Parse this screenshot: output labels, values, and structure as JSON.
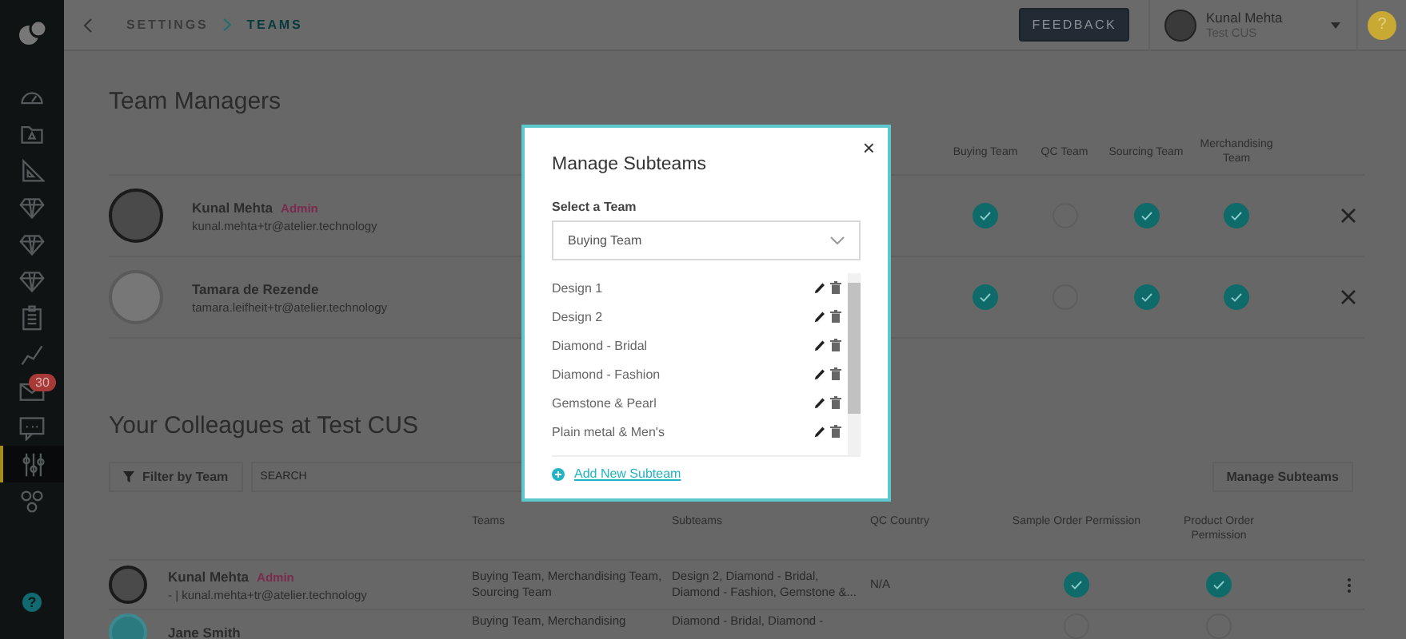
{
  "sidebar": {
    "items": [
      {
        "kind": "dashboard",
        "selected": false
      },
      {
        "kind": "folder",
        "selected": false
      },
      {
        "kind": "ruler",
        "selected": false
      },
      {
        "kind": "gem",
        "selected": false
      },
      {
        "kind": "gem",
        "selected": false
      },
      {
        "kind": "gem",
        "selected": false
      },
      {
        "kind": "clipboard",
        "selected": false
      },
      {
        "kind": "chart",
        "selected": false
      },
      {
        "kind": "mail",
        "selected": false,
        "badge": "30"
      },
      {
        "kind": "chat",
        "selected": false
      },
      {
        "kind": "sliders",
        "selected": true
      },
      {
        "kind": "network",
        "selected": false
      }
    ],
    "help": "?"
  },
  "header": {
    "breadcrumb": [
      {
        "label": "SETTINGS",
        "selected": false
      },
      {
        "label": "TEAMS",
        "selected": true
      }
    ],
    "feedback_button": "FEEDBACK",
    "user": {
      "name": "Kunal Mehta",
      "company": "Test CUS"
    },
    "help": "?"
  },
  "team_managers": {
    "title": "Team Managers",
    "columns": [
      "Buying Team",
      "QC Team",
      "Sourcing Team",
      "Merchandising Team"
    ],
    "rows": [
      {
        "name": "Kunal Mehta",
        "role": "Admin",
        "email": "kunal.mehta+tr@atelier.technology",
        "teams": [
          {
            "checked": true
          },
          {
            "checked": false
          },
          {
            "checked": true
          },
          {
            "checked": true
          }
        ]
      },
      {
        "name": "Tamara de Rezende",
        "email": "tamara.leifheit+tr@atelier.technology",
        "teams": [
          {
            "checked": true
          },
          {
            "checked": false
          },
          {
            "checked": true
          },
          {
            "checked": true
          }
        ]
      }
    ]
  },
  "colleagues": {
    "title": "Your Colleagues at Test CUS",
    "filter_button": "Filter by Team",
    "search": {
      "placeholder": "SEARCH"
    },
    "manage_button": "Manage Subteams",
    "columns": [
      "Teams",
      "Subteams",
      "QC Country",
      "Sample Order Permission",
      "Product Order Permission"
    ],
    "rows": [
      {
        "name": "Kunal Mehta",
        "role": "Admin",
        "email": "- | kunal.mehta+tr@atelier.technology",
        "teams": "Buying Team, Merchandising Team, Sourcing Team",
        "subteams": "Design 2, Diamond - Bridal, Diamond - Fashion, Gemstone &...",
        "qc_country": "N/A",
        "sample_order": {
          "checked": true
        },
        "product_order": {
          "checked": true
        }
      },
      {
        "name": "Jane Smith",
        "teams": "Buying Team, Merchandising",
        "subteams": "Diamond - Bridal, Diamond -",
        "sample_order": {
          "checked": false
        },
        "product_order": {
          "checked": false
        }
      }
    ]
  },
  "modal": {
    "title": "Manage Subteams",
    "close": "×",
    "select_label": "Select a Team",
    "select": {
      "value": "Buying Team"
    },
    "subteams": [
      "Design 1",
      "Design 2",
      "Diamond - Bridal",
      "Diamond - Fashion",
      "Gemstone & Pearl",
      "Plain metal & Men's"
    ],
    "add_link": "Add New Subteam"
  }
}
